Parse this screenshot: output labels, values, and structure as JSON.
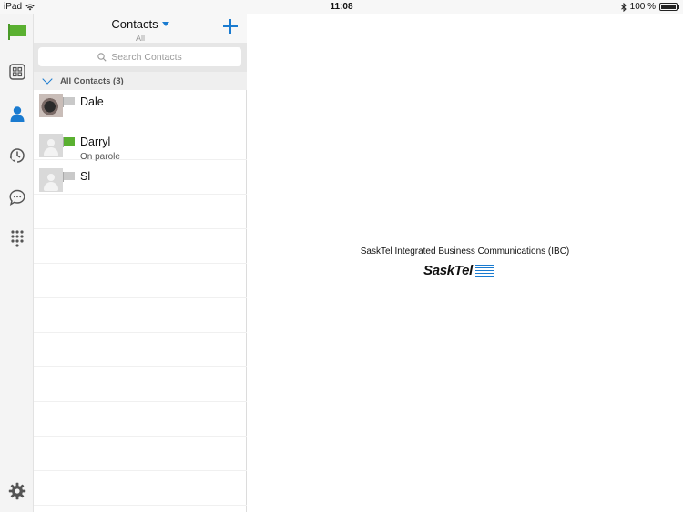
{
  "status_bar": {
    "device": "iPad",
    "time": "11:08",
    "battery": "100 %",
    "battery_level": 1.0
  },
  "rail": {
    "items": [
      {
        "name": "presence-flag-icon",
        "active": false
      },
      {
        "name": "dashboard-icon",
        "active": false
      },
      {
        "name": "contacts-person-icon",
        "active": true
      },
      {
        "name": "call-history-icon",
        "active": false
      },
      {
        "name": "chat-bubble-icon",
        "active": false
      },
      {
        "name": "dialpad-icon",
        "active": false
      }
    ],
    "settings_icon": "gear-icon"
  },
  "contacts_panel": {
    "title": "Contacts",
    "filter": "All",
    "search_placeholder": "Search Contacts",
    "group_label": "All Contacts (3)",
    "contacts": [
      {
        "name": "Dale",
        "status": "",
        "flag": "grey",
        "avatar": "photo"
      },
      {
        "name": "Darryl",
        "status": "On parole",
        "flag": "green",
        "avatar": "default"
      },
      {
        "name": "Sl",
        "status": "",
        "flag": "grey",
        "avatar": "default"
      }
    ]
  },
  "main": {
    "brand_caption": "SaskTel Integrated Business Communications (IBC)",
    "brand_logo_text": "SaskTel"
  },
  "colors": {
    "accent": "#1a7bd0",
    "presence_green": "#5ab031",
    "presence_grey": "#c9c9c9"
  }
}
